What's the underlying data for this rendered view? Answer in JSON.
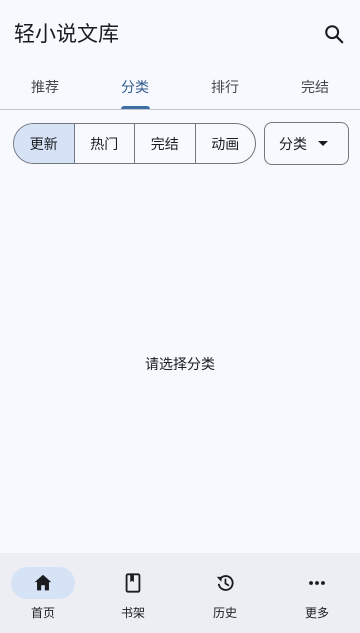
{
  "app": {
    "title": "轻小说文库"
  },
  "tabs": [
    "推荐",
    "分类",
    "排行",
    "完结"
  ],
  "active_tab": "分类",
  "filters": {
    "options": [
      "更新",
      "热门",
      "完结",
      "动画"
    ],
    "selected": "更新"
  },
  "category_dropdown": {
    "label": "分类"
  },
  "empty_state": {
    "message": "请选择分类"
  },
  "bottom_nav": [
    {
      "label": "首页",
      "icon": "home-icon",
      "active": true
    },
    {
      "label": "书架",
      "icon": "book-icon",
      "active": false
    },
    {
      "label": "历史",
      "icon": "history-icon",
      "active": false
    },
    {
      "label": "更多",
      "icon": "more-icon",
      "active": false
    }
  ],
  "colors": {
    "accent": "#3a6ea5",
    "selected_bg": "#d6e3f7",
    "background": "#f8f9ff",
    "nav_bg": "#eceef4"
  }
}
